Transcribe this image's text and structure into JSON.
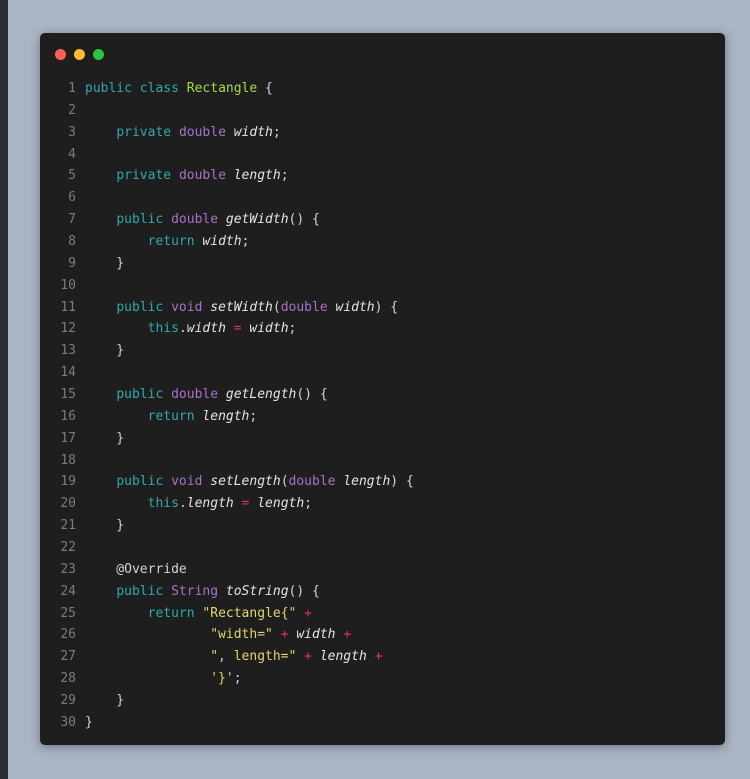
{
  "window": {
    "controls": [
      {
        "name": "close",
        "color": "#ff5f57"
      },
      {
        "name": "minimize",
        "color": "#febc2e"
      },
      {
        "name": "maximize",
        "color": "#28c840"
      }
    ]
  },
  "code": {
    "language": "java",
    "lines": [
      [
        [
          "k",
          "public"
        ],
        [
          "p",
          " "
        ],
        [
          "k",
          "class"
        ],
        [
          "p",
          " "
        ],
        [
          "c",
          "Rectangle"
        ],
        [
          "p",
          " {"
        ]
      ],
      [],
      [
        [
          "p",
          "    "
        ],
        [
          "k",
          "private"
        ],
        [
          "p",
          " "
        ],
        [
          "t",
          "double"
        ],
        [
          "p",
          " "
        ],
        [
          "v",
          "width"
        ],
        [
          "p",
          ";"
        ]
      ],
      [],
      [
        [
          "p",
          "    "
        ],
        [
          "k",
          "private"
        ],
        [
          "p",
          " "
        ],
        [
          "t",
          "double"
        ],
        [
          "p",
          " "
        ],
        [
          "v",
          "length"
        ],
        [
          "p",
          ";"
        ]
      ],
      [],
      [
        [
          "p",
          "    "
        ],
        [
          "k",
          "public"
        ],
        [
          "p",
          " "
        ],
        [
          "t",
          "double"
        ],
        [
          "p",
          " "
        ],
        [
          "v",
          "getWidth"
        ],
        [
          "p",
          "() {"
        ]
      ],
      [
        [
          "p",
          "        "
        ],
        [
          "k",
          "return"
        ],
        [
          "p",
          " "
        ],
        [
          "v",
          "width"
        ],
        [
          "p",
          ";"
        ]
      ],
      [
        [
          "p",
          "    }"
        ]
      ],
      [],
      [
        [
          "p",
          "    "
        ],
        [
          "k",
          "public"
        ],
        [
          "p",
          " "
        ],
        [
          "t",
          "void"
        ],
        [
          "p",
          " "
        ],
        [
          "v",
          "setWidth"
        ],
        [
          "p",
          "("
        ],
        [
          "t",
          "double"
        ],
        [
          "p",
          " "
        ],
        [
          "v",
          "width"
        ],
        [
          "p",
          ") {"
        ]
      ],
      [
        [
          "p",
          "        "
        ],
        [
          "k",
          "this"
        ],
        [
          "p",
          "."
        ],
        [
          "v",
          "width"
        ],
        [
          "p",
          " "
        ],
        [
          "o",
          "="
        ],
        [
          "p",
          " "
        ],
        [
          "v",
          "width"
        ],
        [
          "p",
          ";"
        ]
      ],
      [
        [
          "p",
          "    }"
        ]
      ],
      [],
      [
        [
          "p",
          "    "
        ],
        [
          "k",
          "public"
        ],
        [
          "p",
          " "
        ],
        [
          "t",
          "double"
        ],
        [
          "p",
          " "
        ],
        [
          "v",
          "getLength"
        ],
        [
          "p",
          "() {"
        ]
      ],
      [
        [
          "p",
          "        "
        ],
        [
          "k",
          "return"
        ],
        [
          "p",
          " "
        ],
        [
          "v",
          "length"
        ],
        [
          "p",
          ";"
        ]
      ],
      [
        [
          "p",
          "    }"
        ]
      ],
      [],
      [
        [
          "p",
          "    "
        ],
        [
          "k",
          "public"
        ],
        [
          "p",
          " "
        ],
        [
          "t",
          "void"
        ],
        [
          "p",
          " "
        ],
        [
          "v",
          "setLength"
        ],
        [
          "p",
          "("
        ],
        [
          "t",
          "double"
        ],
        [
          "p",
          " "
        ],
        [
          "v",
          "length"
        ],
        [
          "p",
          ") {"
        ]
      ],
      [
        [
          "p",
          "        "
        ],
        [
          "k",
          "this"
        ],
        [
          "p",
          "."
        ],
        [
          "v",
          "length"
        ],
        [
          "p",
          " "
        ],
        [
          "o",
          "="
        ],
        [
          "p",
          " "
        ],
        [
          "v",
          "length"
        ],
        [
          "p",
          ";"
        ]
      ],
      [
        [
          "p",
          "    }"
        ]
      ],
      [],
      [
        [
          "p",
          "    @Override"
        ]
      ],
      [
        [
          "p",
          "    "
        ],
        [
          "k",
          "public"
        ],
        [
          "p",
          " "
        ],
        [
          "t",
          "String"
        ],
        [
          "p",
          " "
        ],
        [
          "v",
          "toString"
        ],
        [
          "p",
          "() {"
        ]
      ],
      [
        [
          "p",
          "        "
        ],
        [
          "k",
          "return"
        ],
        [
          "p",
          " "
        ],
        [
          "s",
          "\"Rectangle{\""
        ],
        [
          "p",
          " "
        ],
        [
          "o",
          "+"
        ]
      ],
      [
        [
          "p",
          "                "
        ],
        [
          "s",
          "\"width=\""
        ],
        [
          "p",
          " "
        ],
        [
          "o",
          "+"
        ],
        [
          "p",
          " "
        ],
        [
          "v",
          "width"
        ],
        [
          "p",
          " "
        ],
        [
          "o",
          "+"
        ]
      ],
      [
        [
          "p",
          "                "
        ],
        [
          "s",
          "\", length=\""
        ],
        [
          "p",
          " "
        ],
        [
          "o",
          "+"
        ],
        [
          "p",
          " "
        ],
        [
          "v",
          "length"
        ],
        [
          "p",
          " "
        ],
        [
          "o",
          "+"
        ]
      ],
      [
        [
          "p",
          "                "
        ],
        [
          "s",
          "'}'"
        ],
        [
          "p",
          ";"
        ]
      ],
      [
        [
          "p",
          "    }"
        ]
      ],
      [
        [
          "p",
          "}"
        ]
      ]
    ]
  }
}
